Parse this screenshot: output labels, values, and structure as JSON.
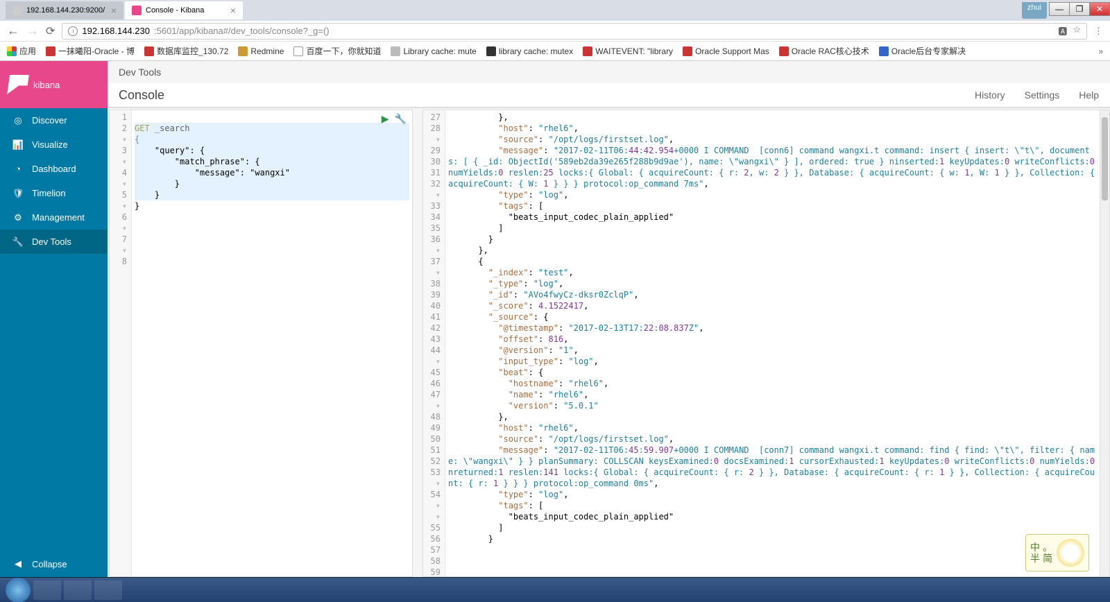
{
  "window": {
    "user": "zhui"
  },
  "tabs": [
    {
      "title": "192.168.144.230:9200/",
      "active": false
    },
    {
      "title": "Console - Kibana",
      "active": true
    }
  ],
  "url": {
    "host": "192.168.144.230",
    "path": ":5601/app/kibana#/dev_tools/console?_g=()"
  },
  "bookmarks_label": "应用",
  "bookmarks": [
    "一抹曦阳-Oracle - 博",
    "数据库监控_130.72",
    "Redmine",
    "百度一下，你就知道",
    "Library cache: mute",
    "library cache: mutex",
    "WAITEVENT: \"library",
    "Oracle Support Mas",
    "Oracle RAC核心技术",
    "Oracle后台专家解决"
  ],
  "brand": "kibana",
  "nav": {
    "discover": "Discover",
    "visualize": "Visualize",
    "dashboard": "Dashboard",
    "timelion": "Timelion",
    "management": "Management",
    "devtools": "Dev Tools",
    "collapse": "Collapse"
  },
  "breadcrumb": "Dev Tools",
  "console_title": "Console",
  "links": {
    "history": "History",
    "settings": "Settings",
    "help": "Help"
  },
  "request": {
    "method": "GET",
    "path": "_search",
    "lines": [
      "1",
      "2",
      "3",
      "4",
      "5",
      "6",
      "7",
      "8"
    ],
    "body": {
      "l2": "{",
      "l3": "    \"query\": {",
      "l4": "        \"match_phrase\": {",
      "l5": "            \"message\": \"wangxi\"",
      "l6": "        }",
      "l7": "    }",
      "l8": "}"
    }
  },
  "response": {
    "lines": [
      "27",
      "28",
      "29",
      "30",
      "",
      "",
      "",
      "",
      "31",
      "32",
      "33",
      "34",
      "35",
      "36",
      "37",
      "38",
      "39",
      "40",
      "41",
      "42",
      "43",
      "44",
      "45",
      "46",
      "47",
      "48",
      "49",
      "50",
      "51",
      "52",
      "53",
      "54",
      "",
      "",
      "",
      "55",
      "56",
      "57",
      "58",
      "59"
    ],
    "code": {
      "l27": "          },",
      "l28": "          \"host\": \"rhel6\",",
      "l29": "          \"source\": \"/opt/logs/firstset.log\",",
      "l30": "          \"message\": \"2017-02-11T06:44:42.954+0000 I COMMAND  [conn6] command wangxi.t command: insert { insert: \\\"t\\\", documents: [ { _id: ObjectId('589eb2da39e265f288b9d9ae'), name: \\\"wangxi\\\" } ], ordered: true } ninserted:1 keyUpdates:0 writeConflicts:0 numYields:0 reslen:25 locks:{ Global: { acquireCount: { r: 2, w: 2 } }, Database: { acquireCount: { w: 1, W: 1 } }, Collection: { acquireCount: { W: 1 } } } protocol:op_command 7ms\",",
      "l31": "          \"type\": \"log\",",
      "l32": "          \"tags\": [",
      "l33": "            \"beats_input_codec_plain_applied\"",
      "l34": "          ]",
      "l35": "        }",
      "l36": "      },",
      "l37": "      {",
      "l38": "        \"_index\": \"test\",",
      "l39": "        \"_type\": \"log\",",
      "l40": "        \"_id\": \"AVo4fwyCz-dksr0ZclqP\",",
      "l41": "        \"_score\": 4.1522417,",
      "l42": "        \"_source\": {",
      "l43": "          \"@timestamp\": \"2017-02-13T17:22:08.837Z\",",
      "l44": "          \"offset\": 816,",
      "l45": "          \"@version\": \"1\",",
      "l46": "          \"input_type\": \"log\",",
      "l47": "          \"beat\": {",
      "l48": "            \"hostname\": \"rhel6\",",
      "l49": "            \"name\": \"rhel6\",",
      "l50": "            \"version\": \"5.0.1\"",
      "l51": "          },",
      "l52": "          \"host\": \"rhel6\",",
      "l53": "          \"source\": \"/opt/logs/firstset.log\",",
      "l54": "          \"message\": \"2017-02-11T06:45:59.907+0000 I COMMAND  [conn7] command wangxi.t command: find { find: \\\"t\\\", filter: { name: \\\"wangxi\\\" } } planSummary: COLLSCAN keysExamined:0 docsExamined:1 cursorExhausted:1 keyUpdates:0 writeConflicts:0 numYields:0 nreturned:1 reslen:141 locks:{ Global: { acquireCount: { r: 2 } }, Database: { acquireCount: { r: 1 } }, Collection: { acquireCount: { r: 1 } } } protocol:op_command 0ms\",",
      "l55": "          \"type\": \"log\",",
      "l56": "          \"tags\": [",
      "l57": "            \"beats_input_codec_plain_applied\"",
      "l58": "          ]",
      "l59": "        }"
    }
  },
  "ime": {
    "a": "中",
    "b": "半",
    "c": "。",
    "d": "简"
  }
}
